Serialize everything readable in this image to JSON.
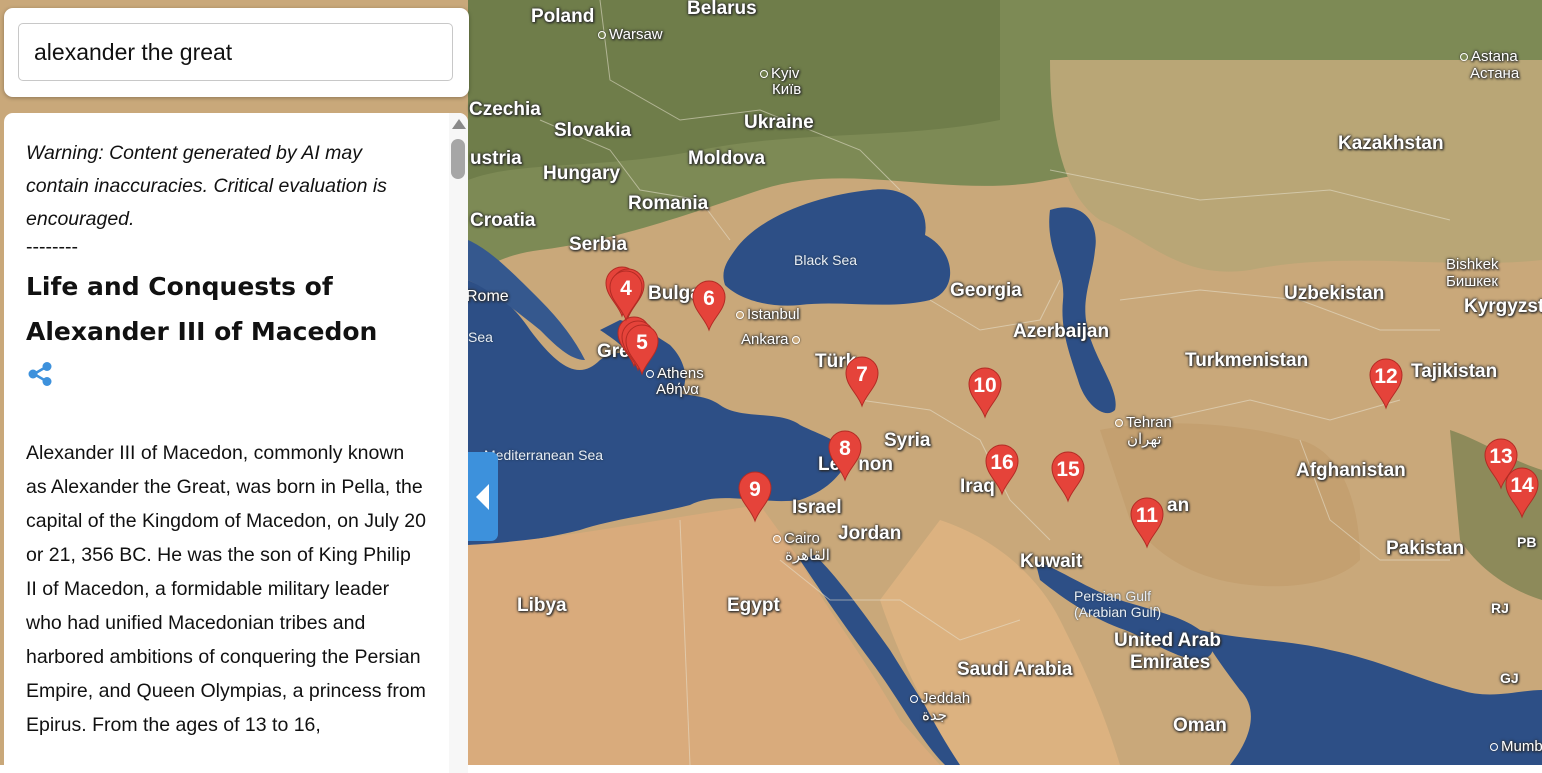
{
  "search": {
    "value": "alexander the great"
  },
  "panel": {
    "warning": "Warning: Content generated by AI may contain inaccuracies. Critical evaluation is encouraged.",
    "divider": "--------",
    "title": "Life and Conquests of Alexander III of Macedon",
    "share_icon": "share-icon",
    "body": "Alexander III of Macedon, commonly known as Alexander the Great, was born in Pella, the capital of the Kingdom of Macedon, on July 20 or 21, 356 BC. He was the son of King Philip II of Macedon, a formidable military leader who had unified Macedonian tribes and harbored ambitions of conquering the Persian Empire, and Queen Olympias, a princess from Epirus. From the ages of 13 to 16,"
  },
  "colors": {
    "accent": "#3d91dc",
    "marker": "#e5433a",
    "sea": "#2d4f86",
    "land": "#c9a87a"
  },
  "map": {
    "labels": {
      "poland": "Poland",
      "belarus": "Belarus",
      "warsaw": "Warsaw",
      "kyiv": "Kyiv",
      "kyiv_local": "Київ",
      "astana": "Astana",
      "astana_local": "Астана",
      "czechia": "Czechia",
      "slovakia": "Slovakia",
      "ukraine": "Ukraine",
      "austria": "ustria",
      "moldova": "Moldova",
      "kazakhstan": "Kazakhstan",
      "hungary": "Hungary",
      "romania": "Romania",
      "croatia": "Croatia",
      "serbia": "Serbia",
      "black_sea": "Black Sea",
      "bishkek": "Bishkek",
      "bishkek_local": "Бишкек",
      "rome": "Rome",
      "bulgaria": "Bulga",
      "istanbul": "Istanbul",
      "georgia": "Georgia",
      "uzbekistan": "Uzbekistan",
      "kyrgyzstan": "Kyrgyzst",
      "ankara": "Ankara",
      "azerbaijan": "Azerbaijan",
      "sea_fragment": "Sea",
      "greece": "Gre",
      "turkmenistan": "Turkmenistan",
      "turkiye": "Türk",
      "athens": "Athens",
      "athens_local": "Αθήνα",
      "tajikistan": "Tajikistan",
      "tehran": "Tehran",
      "tehran_local": "تهران",
      "syria": "Syria",
      "mediterranean": "Mediterranean Sea",
      "lebanon": "Le",
      "lebanon_end": "non",
      "afghanistan": "Afghanistan",
      "iraq": "Iraq",
      "iran": "an",
      "israel": "Israel",
      "cairo": "Cairo",
      "cairo_local": "القاهرة",
      "jordan": "Jordan",
      "pakistan": "Pakistan",
      "pb": "PB",
      "kuwait": "Kuwait",
      "libya": "Libya",
      "egypt": "Egypt",
      "persian_gulf": "Persian Gulf",
      "arabian_gulf": "(Arabian Gulf)",
      "rj": "RJ",
      "uae": "United Arab",
      "uae2": "Emirates",
      "saudi": "Saudi Arabia",
      "gj": "GJ",
      "jeddah": "Jeddah",
      "jeddah_local": "جدة",
      "oman": "Oman",
      "mumbai": "Mumb"
    },
    "markers": [
      {
        "id": "4",
        "label": "4"
      },
      {
        "id": "5",
        "label": "5"
      },
      {
        "id": "6",
        "label": "6"
      },
      {
        "id": "7",
        "label": "7"
      },
      {
        "id": "8",
        "label": "8"
      },
      {
        "id": "9",
        "label": "9"
      },
      {
        "id": "10",
        "label": "10"
      },
      {
        "id": "11",
        "label": "11"
      },
      {
        "id": "12",
        "label": "12"
      },
      {
        "id": "13",
        "label": "13"
      },
      {
        "id": "14",
        "label": "14"
      },
      {
        "id": "15",
        "label": "15"
      },
      {
        "id": "16",
        "label": "16"
      }
    ]
  }
}
